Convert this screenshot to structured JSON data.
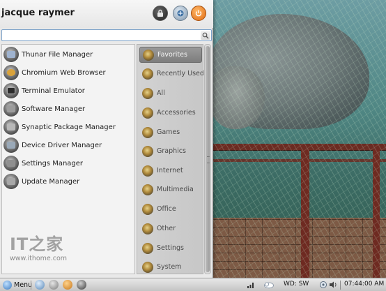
{
  "user": {
    "name": "jacque raymer"
  },
  "header_buttons": [
    {
      "name": "lock-screen-button",
      "icon": "lock-icon"
    },
    {
      "name": "switch-user-button",
      "icon": "switch-user-icon"
    },
    {
      "name": "power-button",
      "icon": "power-icon",
      "color": "#e06a10"
    }
  ],
  "search": {
    "value": "",
    "placeholder": "",
    "icon": "search-icon"
  },
  "applications": [
    {
      "label": "Thunar File Manager",
      "icon": "file-manager-icon",
      "color": "#9fb3cf"
    },
    {
      "label": "Chromium Web Browser",
      "icon": "chromium-icon",
      "color": "#d9a23a"
    },
    {
      "label": "Terminal Emulator",
      "icon": "terminal-icon",
      "color": "#2b2b2b"
    },
    {
      "label": "Software Manager",
      "icon": "software-manager-icon",
      "color": "#9c9c9c"
    },
    {
      "label": "Synaptic Package Manager",
      "icon": "package-manager-icon",
      "color": "#b8b8b8"
    },
    {
      "label": "Device Driver Manager",
      "icon": "driver-manager-icon",
      "color": "#9aa9b8"
    },
    {
      "label": "Settings Manager",
      "icon": "settings-icon",
      "color": "#8f8f8f"
    },
    {
      "label": "Update Manager",
      "icon": "update-manager-icon",
      "color": "#a7a7a7"
    }
  ],
  "categories": [
    {
      "label": "Favorites",
      "icon": "favorites-icon",
      "active": true
    },
    {
      "label": "Recently Used",
      "icon": "recent-icon",
      "active": false
    },
    {
      "label": "All",
      "icon": "all-apps-icon",
      "active": false
    },
    {
      "label": "Accessories",
      "icon": "accessories-icon",
      "active": false
    },
    {
      "label": "Games",
      "icon": "games-icon",
      "active": false
    },
    {
      "label": "Graphics",
      "icon": "graphics-icon",
      "active": false
    },
    {
      "label": "Internet",
      "icon": "internet-icon",
      "active": false
    },
    {
      "label": "Multimedia",
      "icon": "multimedia-icon",
      "active": false
    },
    {
      "label": "Office",
      "icon": "office-icon",
      "active": false
    },
    {
      "label": "Other",
      "icon": "other-icon",
      "active": false
    },
    {
      "label": "Settings",
      "icon": "settings-category-icon",
      "active": false
    },
    {
      "label": "System",
      "icon": "system-icon",
      "active": false
    }
  ],
  "watermark": {
    "logo": "IT之家",
    "url": "www.ithome.com"
  },
  "taskbar": {
    "menu_label": "Menu",
    "launchers": [
      "browser-launcher-icon",
      "file-manager-launcher-icon",
      "chromium-launcher-icon",
      "terminal-launcher-icon"
    ],
    "workspace": "WD: SW",
    "clock": "07:44:00 AM",
    "tray": [
      "network-icon",
      "weather-icon",
      "battery-icon",
      "volume-icon"
    ]
  },
  "colors": {
    "accent": "#7ba1c9",
    "active_category": "#8a8a8a",
    "menu_bg": "#e9e9e9"
  }
}
